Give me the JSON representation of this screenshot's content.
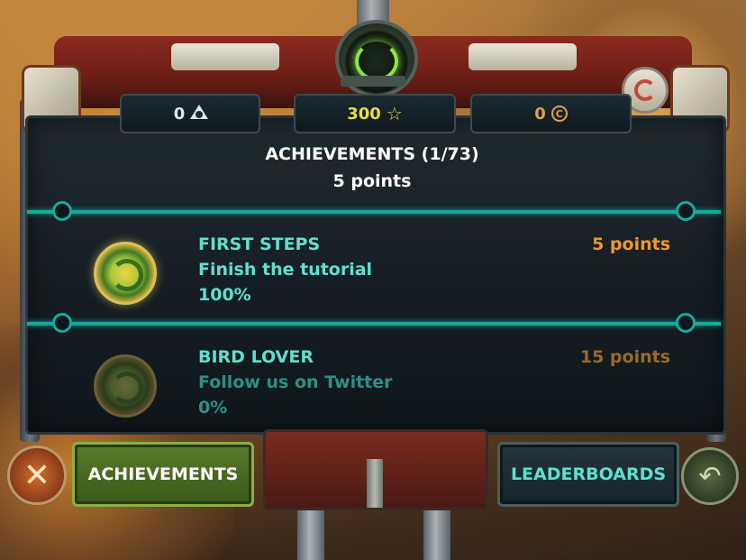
{
  "stats": {
    "triangles": "0",
    "stars": "300",
    "coins": "0"
  },
  "header": {
    "title": "ACHIEVEMENTS (1/73)",
    "total_points": "5 points"
  },
  "achievements": [
    {
      "name": "FIRST STEPS",
      "description": "Finish the tutorial",
      "progress": "100%",
      "points": "5 points",
      "unlocked": true
    },
    {
      "name": "BIRD LOVER",
      "description": "Follow us on Twitter",
      "progress": "0%",
      "points": "15 points",
      "unlocked": false
    }
  ],
  "buttons": {
    "achievements": "ACHIEVEMENTS",
    "leaderboards": "LEADERBOARDS",
    "close_icon": "✕",
    "back_icon": "↶"
  },
  "colors": {
    "teal": "#17a99a",
    "name_unlocked": "#5fe0ce",
    "name_locked": "#2f8f84",
    "points_unlocked": "#f0972a",
    "points_locked": "#9a6a2a",
    "star_yellow": "#e7dc46"
  },
  "icons": {
    "triangles": "eye-triangle-icon",
    "stars": "star-icon",
    "coins": "coin-icon"
  }
}
